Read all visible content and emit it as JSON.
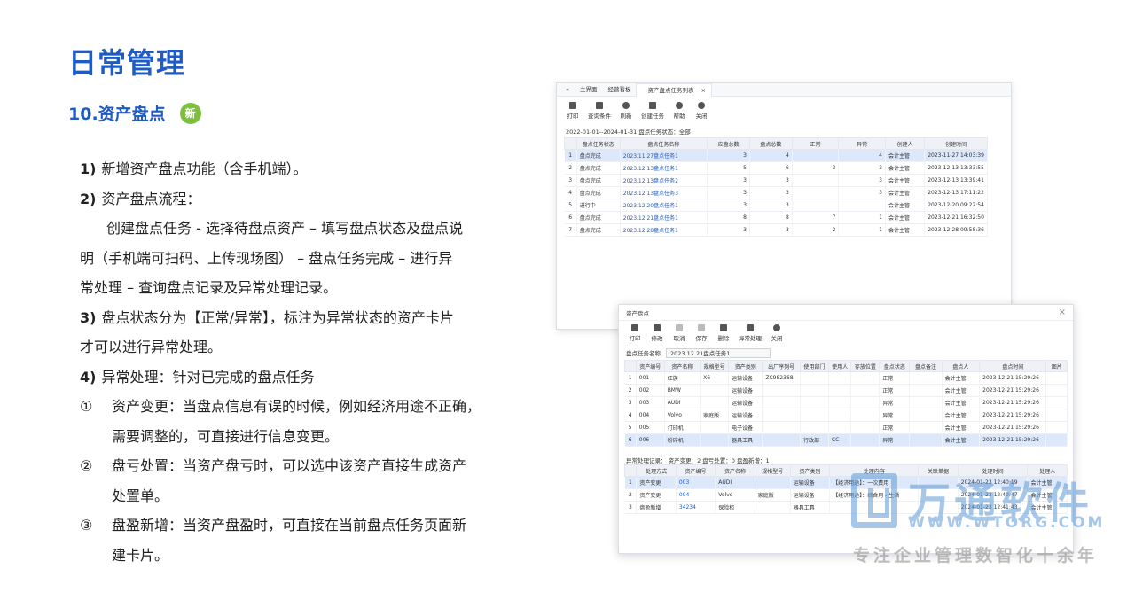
{
  "title": "日常管理",
  "subtitle": "10.资产盘点",
  "new_badge": "新",
  "text": {
    "p1_num": "1)",
    "p1": "新增资产盘点功能（含手机端）。",
    "p2_num": "2)",
    "p2": "资产盘点流程：",
    "p2_l1": "创建盘点任务 - 选择待盘点资产 – 填写盘点状态及盘点说",
    "p2_l2": "明（手机端可扫码、上传现场图）  – 盘点任务完成 – 进行异",
    "p2_l3": "常处理 – 查询盘点记录及异常处理记录。",
    "p3_num": "3)",
    "p3_l1": "盘点状态分为【正常/异常】，标注为异常状态的资产卡片",
    "p3_l2": "才可以进行异常处理。",
    "p4_num": "4)",
    "p4": "异常处理：针对已完成的盘点任务",
    "i1_mark": "①",
    "i1_l1": "资产变更：当盘点信息有误的时候，例如经济用途不正确，",
    "i1_l2": "需要调整的，可直接进行信息变更。",
    "i2_mark": "②",
    "i2_l1": "盘亏处置：当资产盘亏时，可以选中该资产直接生成资产",
    "i2_l2": "处置单。",
    "i3_mark": "③",
    "i3_l1": "盘盈新增：当资产盘盈时，可直接在当前盘点任务页面新",
    "i3_l2": "建卡片。"
  },
  "win1": {
    "tabs": [
      "主界面",
      "经营看板",
      "资产盘点任务列表"
    ],
    "toolbar": [
      "打印",
      "查询条件",
      "刷新",
      "创建任务",
      "帮助",
      "关闭"
    ],
    "filter": "2022-01-01--2024-01-31   盘点任务状态：全部",
    "columns": [
      "",
      "盘点任务状态",
      "盘点任务名称",
      "应盘总数",
      "盘点总数",
      "正常",
      "异常",
      "创建人",
      "创建时间"
    ],
    "rows": [
      [
        "1",
        "盘点完成",
        "2023.11.27盘点任务1",
        "3",
        "4",
        "",
        "4",
        "会计主管",
        "2023-11-27 14:03:39"
      ],
      [
        "2",
        "盘点完成",
        "2023.12.13盘点任务1",
        "5",
        "6",
        "3",
        "3",
        "会计主管",
        "2023-12-13 13:33:55"
      ],
      [
        "3",
        "盘点完成",
        "2023.12.13盘点任务2",
        "3",
        "3",
        "",
        "3",
        "会计主管",
        "2023-12-13 13:39:41"
      ],
      [
        "4",
        "盘点完成",
        "2023.12.13盘点任务3",
        "3",
        "3",
        "",
        "3",
        "会计主管",
        "2023-12-13 17:11:22"
      ],
      [
        "5",
        "进行中",
        "2023.12.20盘点任务1",
        "3",
        "3",
        "",
        "",
        "会计主管",
        "2023-12-20 09:22:54"
      ],
      [
        "6",
        "盘点完成",
        "2023.12.21盘点任务1",
        "8",
        "8",
        "7",
        "1",
        "会计主管",
        "2023-12-21 16:32:50"
      ],
      [
        "7",
        "盘点完成",
        "2023.12.28盘点任务1",
        "3",
        "3",
        "2",
        "1",
        "会计主管",
        "2023-12-28 09:58:36"
      ]
    ]
  },
  "win2": {
    "title": "资产盘点",
    "close": "×",
    "toolbar": [
      "打印",
      "修改",
      "取消",
      "保存",
      "删除",
      "异常处理",
      "关闭"
    ],
    "field_label": "盘点任务名称",
    "field_value": "2023.12.21盘点任务1",
    "columns": [
      "",
      "资产编号",
      "资产名称",
      "规格型号",
      "资产类别",
      "出厂序列号",
      "使用部门",
      "使用人",
      "存放位置",
      "盘点状态",
      "盘点备注",
      "盘点人",
      "盘点时间",
      "图片"
    ],
    "rows": [
      [
        "1",
        "001",
        "红旗",
        "X6",
        "运输设备",
        "ZC982368",
        "",
        "",
        "",
        "正常",
        "",
        "会计主管",
        "2023-12-21 15:29:26",
        ""
      ],
      [
        "2",
        "002",
        "BMW",
        "",
        "运输设备",
        "",
        "",
        "",
        "",
        "正常",
        "",
        "会计主管",
        "2023-12-21 15:29:26",
        ""
      ],
      [
        "3",
        "003",
        "AUDI",
        "",
        "运输设备",
        "",
        "",
        "",
        "",
        "异常",
        "",
        "会计主管",
        "2023-12-21 15:29:26",
        ""
      ],
      [
        "4",
        "004",
        "Volvo",
        "家庭版",
        "运输设备",
        "",
        "",
        "",
        "",
        "异常",
        "",
        "会计主管",
        "2023-12-21 15:29:26",
        ""
      ],
      [
        "5",
        "005",
        "打印机",
        "",
        "电子设备",
        "",
        "",
        "",
        "",
        "正常",
        "",
        "会计主管",
        "2023-12-21 15:29:26",
        ""
      ],
      [
        "6",
        "006",
        "粉碎机",
        "",
        "器具工具",
        "",
        "行政部",
        "CC",
        "",
        "异常",
        "",
        "会计主管",
        "2023-12-21 15:29:26",
        ""
      ]
    ],
    "section_label": "异常处理记录：  资产变更：2   盘亏处置：0   盘盈新增：1",
    "sub_columns": [
      "",
      "处理方式",
      "资产编号",
      "资产名称",
      "规格型号",
      "资产类别",
      "处理内容",
      "关联单据",
      "处理时间",
      "处理人"
    ],
    "sub_rows": [
      [
        "1",
        "资产变更",
        "003",
        "AUDI",
        "",
        "运输设备",
        "【经济用途】：一次费用",
        "",
        "2024-01-23 12:40:19",
        "会计主管"
      ],
      [
        "2",
        "资产变更",
        "004",
        "Volvo",
        "家庭版",
        "运输设备",
        "【经济用途】：综合用 - 生活",
        "",
        "2024-01-23 12:40:47",
        "会计主管"
      ],
      [
        "3",
        "盘盈新增",
        "34234",
        "保险柜",
        "",
        "器具工具",
        "",
        "",
        "2024-01-23 12:41:43",
        "会计主管"
      ]
    ]
  },
  "watermark": {
    "name": "万通软件",
    "url": "WWW.WTORG.COM",
    "slogan": "专注企业管理数智化十余年"
  }
}
